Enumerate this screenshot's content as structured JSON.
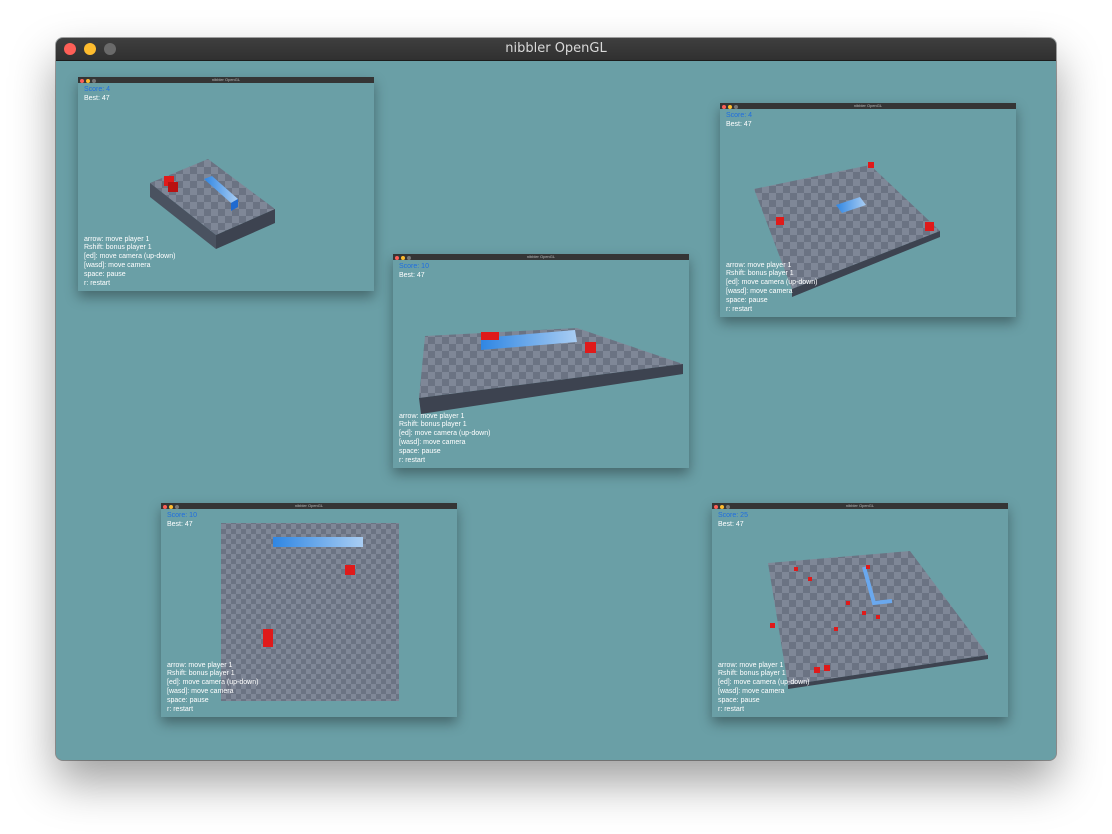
{
  "window": {
    "title": "nibbler OpenGL"
  },
  "colors": {
    "background": "#6a9fa6",
    "score_text": "#1f6ee0",
    "snake": "#3a8de0",
    "food": "#e01a1a",
    "board_dark": "#6b7383",
    "board_light": "#7f8797"
  },
  "game_windows": [
    {
      "title": "nibbler OpenGL",
      "score": "Score: 4",
      "best": "Best: 47"
    },
    {
      "title": "nibbler OpenGL",
      "score": "Score: 4",
      "best": "Best: 47"
    },
    {
      "title": "nibbler OpenGL",
      "score": "Score: 10",
      "best": "Best: 47"
    },
    {
      "title": "nibbler OpenGL",
      "score": "Score: 10",
      "best": "Best: 47"
    },
    {
      "title": "nibbler OpenGL",
      "score": "Score: 25",
      "best": "Best: 47"
    }
  ],
  "help": [
    "arrow: move player 1",
    "Rshift: bonus player 1",
    "[ed]: move camera (up-down)",
    "[wasd]: move camera",
    "space: pause",
    "r: restart"
  ]
}
